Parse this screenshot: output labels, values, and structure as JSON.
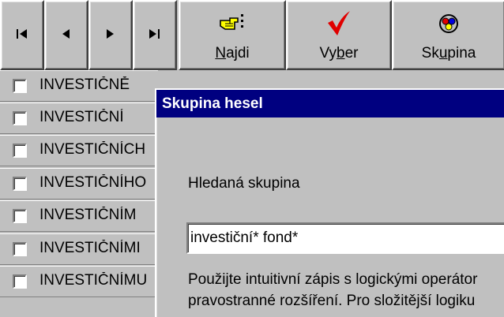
{
  "toolbar": {
    "nav": [
      {
        "name": "first-record-button",
        "icon": "first-record-icon"
      },
      {
        "name": "previous-record-button",
        "icon": "previous-record-icon"
      },
      {
        "name": "next-record-button",
        "icon": "next-record-icon"
      },
      {
        "name": "last-record-button",
        "icon": "last-record-icon"
      }
    ],
    "najdi": {
      "pre": "",
      "key": "N",
      "post": "ajdi",
      "icon": "pointing-hand-icon"
    },
    "vyber": {
      "pre": "Vy",
      "key": "b",
      "post": "er",
      "icon": "checkmark-icon"
    },
    "skupina": {
      "pre": "Sk",
      "key": "u",
      "post": "pina",
      "icon": "group-icon"
    }
  },
  "list": {
    "items": [
      {
        "label": "INVESTIČNĚ",
        "checked": false
      },
      {
        "label": "INVESTIČNÍ",
        "checked": false
      },
      {
        "label": "INVESTIČNÍCH",
        "checked": false
      },
      {
        "label": "INVESTIČNÍHO",
        "checked": false
      },
      {
        "label": "INVESTIČNÍM",
        "checked": false
      },
      {
        "label": "INVESTIČNÍMI",
        "checked": false
      },
      {
        "label": "INVESTIČNÍMU",
        "checked": false
      }
    ]
  },
  "dialog": {
    "title": "Skupina hesel",
    "label": "Hledaná skupina",
    "input_value": "investiční* fond*",
    "hint_line1": "Použijte intuitivní zápis s logickými operátor",
    "hint_line2": "pravostranné rozšíření. Pro složitější logiku"
  },
  "colors": {
    "face": "#c0c0c0",
    "title_bar": "#000080",
    "check_red": "#e00000"
  }
}
